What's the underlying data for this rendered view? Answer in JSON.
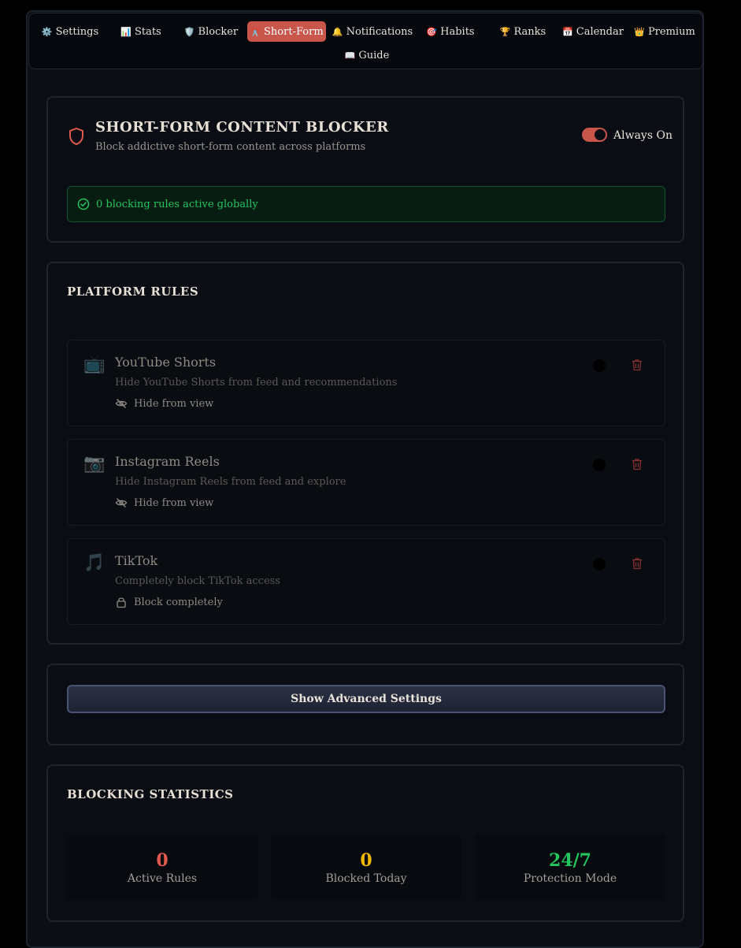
{
  "colors": {
    "accent": "#c9564a",
    "success": "#22c55e",
    "warning": "#f5b800",
    "danger": "#e05a4f"
  },
  "nav": {
    "tabs": [
      {
        "icon": "⚙️",
        "label": "Settings"
      },
      {
        "icon": "📊",
        "label": "Stats"
      },
      {
        "icon": "🛡️",
        "label": "Blocker"
      },
      {
        "icon": "✂️",
        "label": "Short-Form"
      },
      {
        "icon": "🔔",
        "label": "Notifications"
      },
      {
        "icon": "🎯",
        "label": "Habits"
      },
      {
        "icon": "🏆",
        "label": "Ranks"
      },
      {
        "icon": "📅",
        "label": "Calendar"
      },
      {
        "icon": "👑",
        "label": "Premium"
      },
      {
        "icon": "📖",
        "label": "Guide"
      }
    ],
    "active": "Short-Form"
  },
  "header": {
    "title": "SHORT-FORM CONTENT BLOCKER",
    "subtitle": "Block addictive short-form content across platforms",
    "toggle_label": "Always On",
    "toggle_on": true,
    "status": "0 blocking rules active globally"
  },
  "rules": {
    "title": "PLATFORM RULES",
    "items": [
      {
        "icon": "📺",
        "name": "YouTube Shorts",
        "description": "Hide YouTube Shorts from feed and recommendations",
        "mode": "Hide from view",
        "mode_icon": "eye-off-icon",
        "enabled": false
      },
      {
        "icon": "📷",
        "name": "Instagram Reels",
        "description": "Hide Instagram Reels from feed and explore",
        "mode": "Hide from view",
        "mode_icon": "eye-off-icon",
        "enabled": false
      },
      {
        "icon": "🎵",
        "name": "TikTok",
        "description": "Completely block TikTok access",
        "mode": "Block completely",
        "mode_icon": "lock-icon",
        "enabled": false
      }
    ]
  },
  "advanced": {
    "button_label": "Show Advanced Settings"
  },
  "statistics": {
    "title": "BLOCKING STATISTICS",
    "items": [
      {
        "value": "0",
        "label": "Active Rules",
        "color": "#e05a4f"
      },
      {
        "value": "0",
        "label": "Blocked Today",
        "color": "#f5b800"
      },
      {
        "value": "24/7",
        "label": "Protection Mode",
        "color": "#22c55e"
      }
    ]
  }
}
